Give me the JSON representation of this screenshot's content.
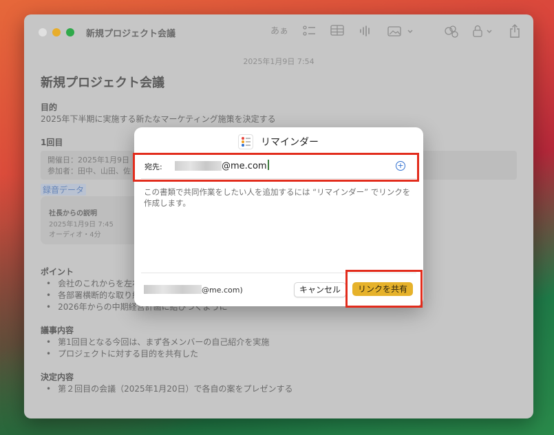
{
  "window": {
    "title": "新規プロジェクト会議",
    "toolbar": {
      "format_label": "あぁ"
    }
  },
  "note": {
    "datestamp": "2025年1月9日 7:54",
    "title": "新規プロジェクト会議",
    "purpose_heading": "目的",
    "purpose_text": "2025年下半期に実施する新たなマーケティング施策を決定する",
    "round_heading": "1回目",
    "info_date": "開催日：2025年1月9日",
    "info_attendees": "参加者：田中、山田、佐",
    "recording_label": "録音データ",
    "audio_card": {
      "title": "社長からの説明",
      "date": "2025年1月9日 7:45",
      "meta": "オーディオ・4分"
    },
    "points_heading": "ポイント",
    "points": [
      "会社のこれからを左右",
      "各部署横断的な取り組",
      "2026年からの中期経営計画に結びつくように"
    ],
    "agenda_heading": "議事内容",
    "agenda": [
      "第1回目となる今回は、まず各メンバーの自己紹介を実施",
      "プロジェクトに対する目的を共有した"
    ],
    "decision_heading": "決定内容",
    "decisions": [
      "第２回目の会議（2025年1月20日）で各自の案をプレゼンする"
    ]
  },
  "dialog": {
    "title": "リマインダー",
    "to_label": "宛先:",
    "to_domain": "@me.com",
    "description": "この書類で共同作業をしたい人を追加するには “リマインダー” でリンクを作成します。",
    "user_suffix": "@me.com)",
    "cancel_label": "キャンセル",
    "share_label": "リンクを共有"
  },
  "colors": {
    "highlight": "#e22c1c",
    "share_button": "#e6b22b",
    "accent": "#2f6fd0"
  }
}
